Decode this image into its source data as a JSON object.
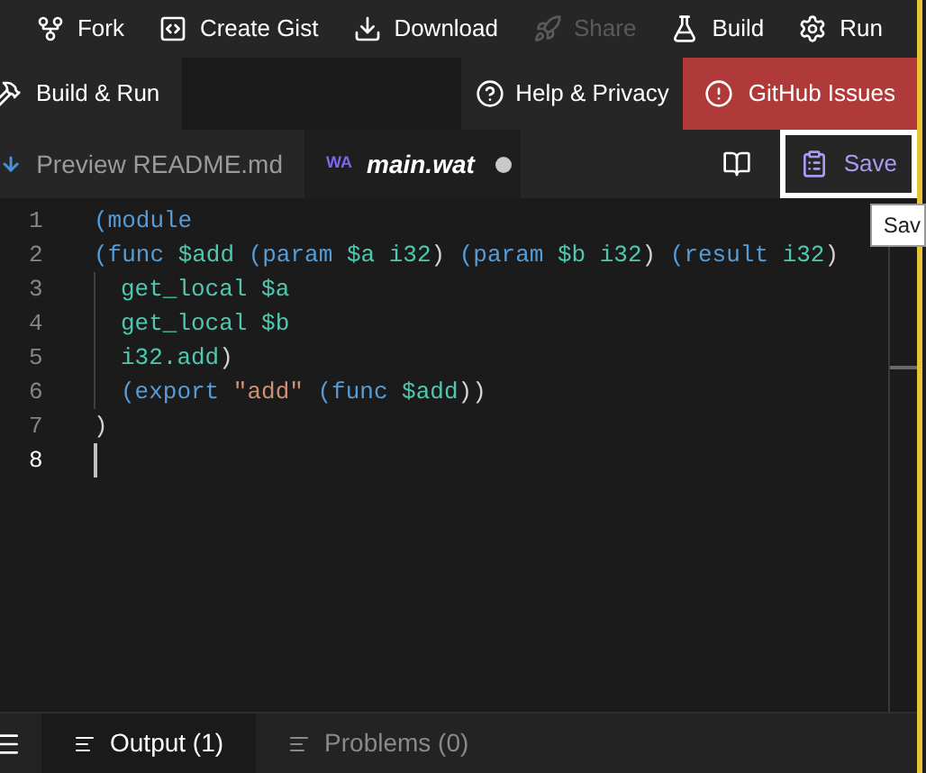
{
  "toolbar": [
    {
      "label": "Fork",
      "disabled": false
    },
    {
      "label": "Create Gist",
      "disabled": false
    },
    {
      "label": "Download",
      "disabled": false
    },
    {
      "label": "Share",
      "disabled": true
    },
    {
      "label": "Build",
      "disabled": false
    },
    {
      "label": "Run",
      "disabled": false
    }
  ],
  "secondary_bar": {
    "build_run": "Build & Run",
    "help": "Help & Privacy",
    "issues": "GitHub Issues"
  },
  "tabs": [
    {
      "label": "Preview README.md",
      "kind": "preview",
      "selected": false,
      "modified": false
    },
    {
      "label": "main.wat",
      "kind": "file",
      "badge": "WA",
      "selected": true,
      "modified": true
    }
  ],
  "save_button": {
    "label": "Save",
    "focused": true
  },
  "tooltip": "Sav",
  "editor": {
    "lines": [
      {
        "number": "1",
        "indented": false,
        "current": false,
        "tokens": [
          {
            "text": "(module",
            "kind": "keyword"
          }
        ]
      },
      {
        "number": "2",
        "indented": false,
        "current": false,
        "tokens": [
          {
            "text": "(func ",
            "kind": "keyword"
          },
          {
            "text": "$add ",
            "kind": "var"
          },
          {
            "text": "(param ",
            "kind": "keyword"
          },
          {
            "text": "$a i32",
            "kind": "var"
          },
          {
            "text": ") ",
            "kind": "punct"
          },
          {
            "text": "(param ",
            "kind": "keyword"
          },
          {
            "text": "$b i32",
            "kind": "var"
          },
          {
            "text": ") ",
            "kind": "punct"
          },
          {
            "text": "(result ",
            "kind": "keyword"
          },
          {
            "text": "i32",
            "kind": "var"
          },
          {
            "text": ")",
            "kind": "punct"
          }
        ]
      },
      {
        "number": "3",
        "indented": true,
        "current": false,
        "tokens": [
          {
            "text": "get_local ",
            "kind": "var"
          },
          {
            "text": "$a",
            "kind": "var"
          }
        ]
      },
      {
        "number": "4",
        "indented": true,
        "current": false,
        "tokens": [
          {
            "text": "get_local ",
            "kind": "var"
          },
          {
            "text": "$b",
            "kind": "var"
          }
        ]
      },
      {
        "number": "5",
        "indented": true,
        "current": false,
        "tokens": [
          {
            "text": "i32.add",
            "kind": "var"
          },
          {
            "text": ")",
            "kind": "punct"
          }
        ]
      },
      {
        "number": "6",
        "indented": true,
        "current": false,
        "tokens": [
          {
            "text": "(export ",
            "kind": "keyword"
          },
          {
            "text": "\"add\" ",
            "kind": "string"
          },
          {
            "text": "(func ",
            "kind": "keyword"
          },
          {
            "text": "$add",
            "kind": "var"
          },
          {
            "text": "))",
            "kind": "punct"
          }
        ]
      },
      {
        "number": "7",
        "indented": false,
        "current": false,
        "tokens": [
          {
            "text": ")",
            "kind": "punct"
          }
        ]
      },
      {
        "number": "8",
        "indented": false,
        "current": true
      }
    ]
  },
  "panel_tabs": [
    {
      "label": "Output (1)",
      "selected": true
    },
    {
      "label": "Problems (0)",
      "selected": false
    }
  ]
}
